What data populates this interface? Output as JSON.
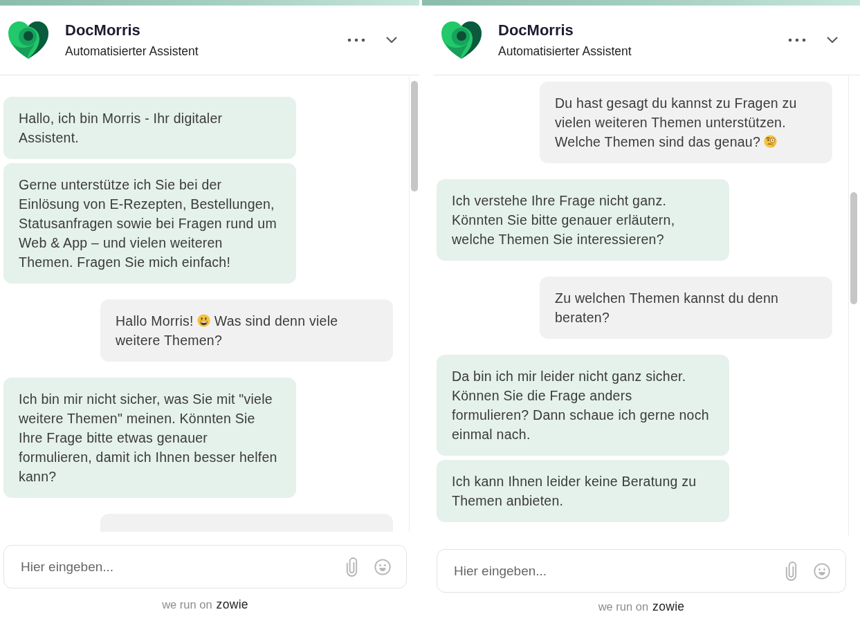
{
  "panels": [
    {
      "header": {
        "title": "DocMorris",
        "subtitle": "Automatisierter Assistent"
      },
      "messages": [
        {
          "kind": "bot",
          "segments": [
            {
              "kind": "text",
              "text": "Hallo, ich bin Morris - Ihr digitaler Assistent."
            }
          ]
        },
        {
          "kind": "bot",
          "segments": [
            {
              "kind": "text",
              "text": "Gerne unterstütze ich Sie bei der Einlösung von E-Rezepten, Bestellungen, Statusanfragen sowie bei Fragen rund um Web & App – und vielen weiteren Themen. Fragen Sie mich einfach!"
            }
          ]
        },
        {
          "kind": "user",
          "segments": [
            {
              "kind": "text",
              "text": "Hallo Morris!"
            },
            {
              "kind": "grin"
            },
            {
              "kind": "text",
              "text": "Was sind denn viele"
            },
            {
              "kind": "text",
              "text": "weitere Themen?"
            }
          ]
        },
        {
          "kind": "bot",
          "segments": [
            {
              "kind": "text",
              "text": "Ich bin mir nicht sicher, was Sie mit \"viele weitere Themen\" meinen. Könnten Sie Ihre Frage bitte etwas genauer formulieren, damit ich Ihnen besser helfen kann?"
            }
          ]
        },
        {
          "kind": "user"
        }
      ],
      "composer": {
        "placeholder": "Hier eingeben..."
      },
      "footer": {
        "prefix": "we run on",
        "brand": "zowie"
      }
    },
    {
      "header": {
        "title": "DocMorris",
        "subtitle": "Automatisierter Assistent"
      },
      "messages": [
        {
          "kind": "user",
          "segments": [
            {
              "kind": "text",
              "text": "Du hast gesagt du kannst zu Fragen zu vielen weiteren Themen unterstützen."
            },
            {
              "kind": "text",
              "text": "Welche Themen sind das genau?"
            },
            {
              "kind": "monocle"
            }
          ]
        },
        {
          "kind": "bot",
          "segments": [
            {
              "kind": "text",
              "text": "Ich verstehe Ihre Frage nicht ganz. Könnten Sie bitte genauer erläutern, welche Themen Sie interessieren?"
            }
          ]
        },
        {
          "kind": "user",
          "segments": [
            {
              "kind": "text",
              "text": "Zu welchen Themen kannst du denn beraten?"
            }
          ]
        },
        {
          "kind": "bot",
          "segments": [
            {
              "kind": "text",
              "text": "Da bin ich mir leider nicht ganz sicher. Können Sie die Frage anders formulieren? Dann schaue ich gerne noch einmal nach."
            }
          ]
        },
        {
          "kind": "bot",
          "segments": [
            {
              "kind": "text",
              "text": "Ich kann Ihnen leider keine Beratung zu Themen anbieten."
            }
          ]
        }
      ],
      "composer": {
        "placeholder": "Hier eingeben..."
      },
      "footer": {
        "prefix": "we run on",
        "brand": "zowie"
      }
    }
  ]
}
